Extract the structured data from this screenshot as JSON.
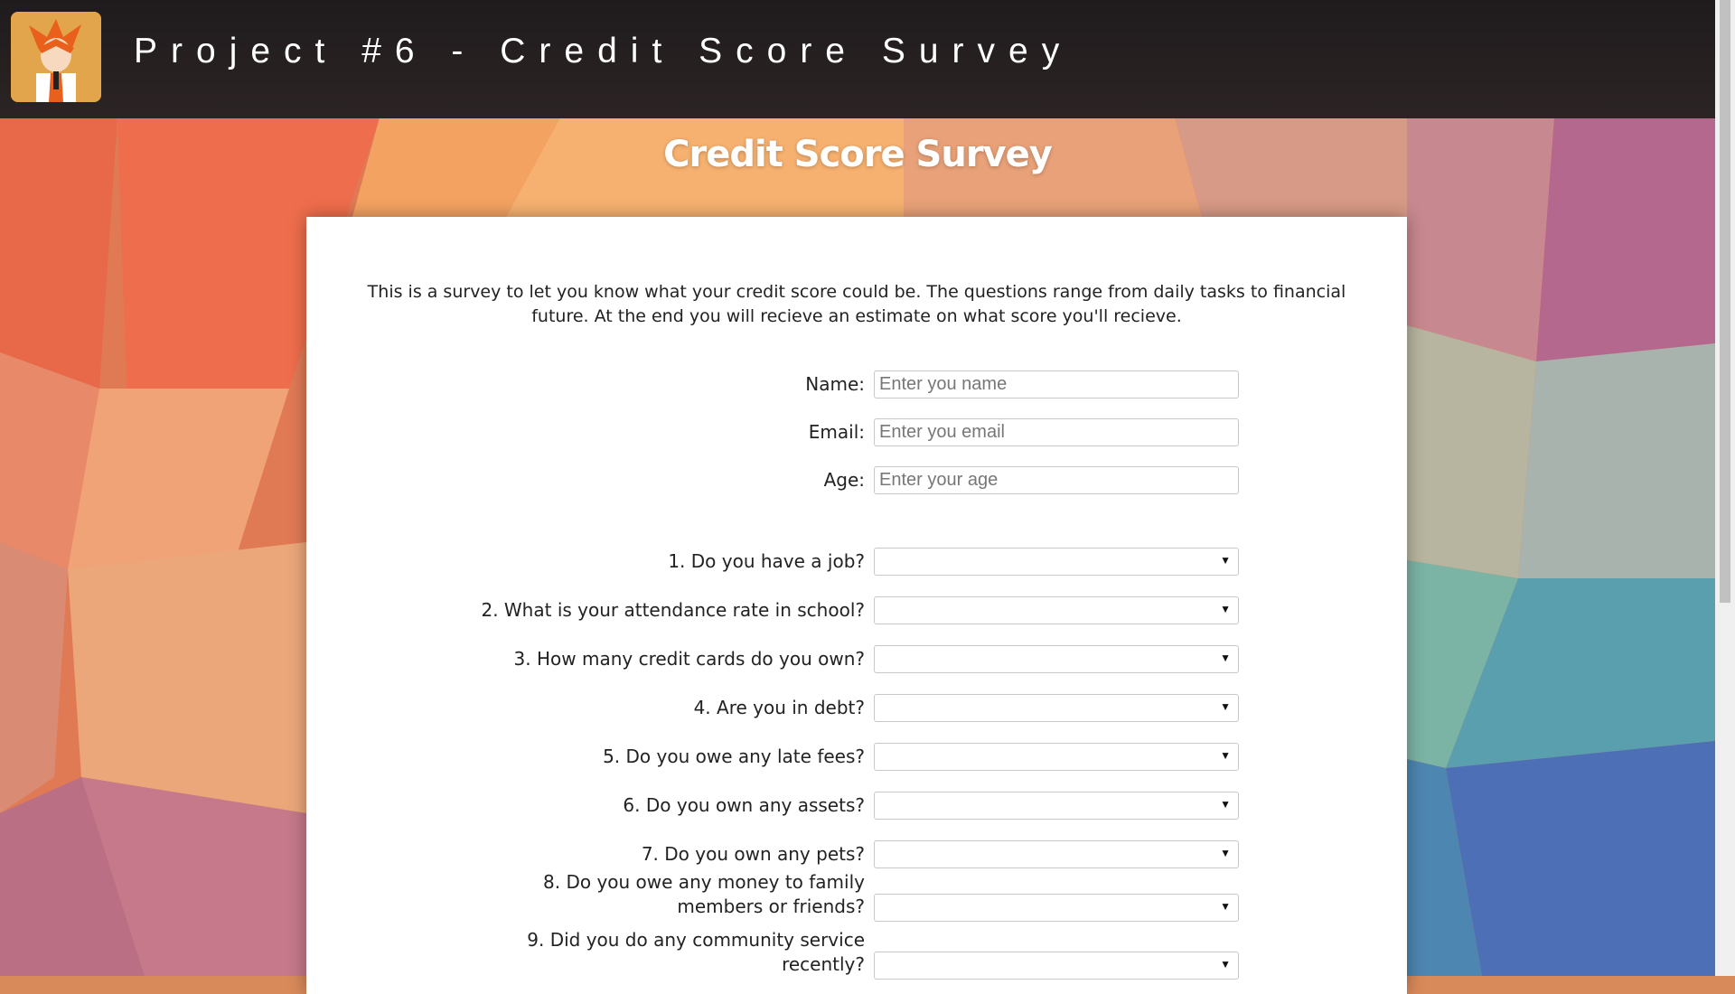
{
  "header": {
    "site_title": "Project #6 - Credit Score Survey"
  },
  "page": {
    "title": "Credit Score Survey"
  },
  "survey": {
    "intro": "This is a survey to let you know what your credit score could be. The questions range from daily tasks to financial future. At the end you will recieve an estimate on what score you'll recieve.",
    "name_label": "Name:",
    "name_placeholder": "Enter you name",
    "email_label": "Email:",
    "email_placeholder": "Enter you email",
    "age_label": "Age:",
    "age_placeholder": "Enter your age",
    "questions": [
      {
        "label": "1. Do you have a job?",
        "value": ""
      },
      {
        "label": "2. What is your attendance rate in school?",
        "value": ""
      },
      {
        "label": "3. How many credit cards do you own?",
        "value": ""
      },
      {
        "label": "4. Are you in debt?",
        "value": ""
      },
      {
        "label": "5. Do you owe any late fees?",
        "value": ""
      },
      {
        "label": "6. Do you own any assets?",
        "value": ""
      },
      {
        "label": "7. Do you own any pets?",
        "value": ""
      },
      {
        "label": "8. Do you owe any money to family members or friends?",
        "value": ""
      },
      {
        "label": "9. Did you do any community service recently?",
        "value": ""
      }
    ]
  },
  "icons": {
    "dropdown": "chevron-down-icon",
    "logo": "anime-avatar-logo"
  }
}
